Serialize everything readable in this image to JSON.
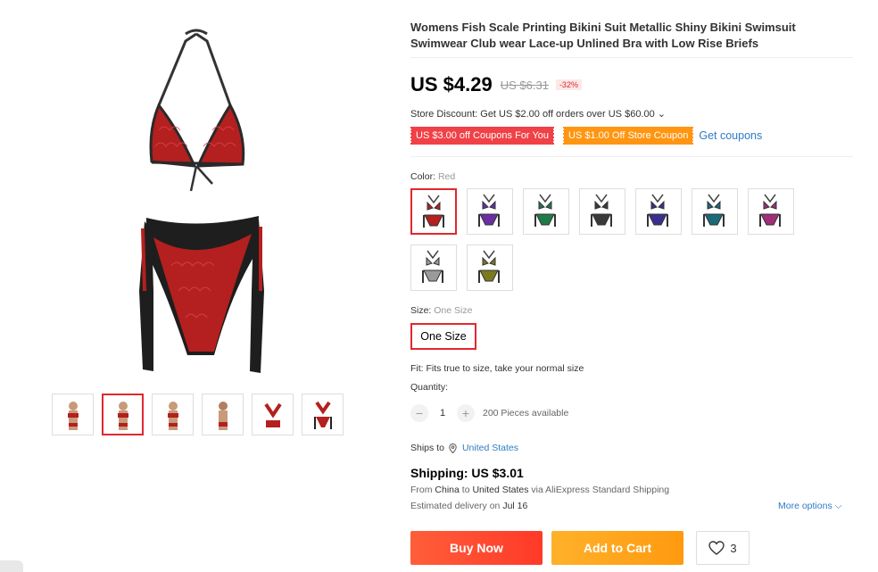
{
  "product": {
    "title": "Womens Fish Scale Printing Bikini Suit Metallic Shiny Bikini Swimsuit Swimwear Club wear Lace-up Unlined Bra with Low Rise Briefs",
    "price": "US $4.29",
    "original_price": "US $6.31",
    "discount": "-32%"
  },
  "store_discount": "Store Discount: Get US $2.00 off orders over US $60.00 ⌄",
  "coupons": {
    "coupon1": "US $3.00 off Coupons For You",
    "coupon2": "US $1.00 Off Store Coupon",
    "get_coupons": "Get coupons"
  },
  "color": {
    "label": "Color: ",
    "selected": "Red",
    "swatches": [
      {
        "color": "#b3201f"
      },
      {
        "color": "#6a2fa0"
      },
      {
        "color": "#1f7a4a"
      },
      {
        "color": "#3a3a3a"
      },
      {
        "color": "#3a2f8f"
      },
      {
        "color": "#1a6a7a"
      },
      {
        "color": "#a02f7a"
      },
      {
        "color": "#9a9a9a"
      },
      {
        "color": "#7a7a20"
      }
    ]
  },
  "size": {
    "label": "Size: ",
    "selected": "One Size",
    "option": "One Size"
  },
  "fit": "Fit: Fits true to size, take your normal size",
  "quantity": {
    "label": "Quantity:",
    "value": "1",
    "available": "200 Pieces available",
    "minus": "−",
    "plus": "+"
  },
  "shipping": {
    "ships_to_label": "Ships to",
    "country": "United States",
    "cost": "Shipping: US $3.01",
    "from_prefix": "From ",
    "from_origin": "China",
    "from_mid": " to ",
    "from_dest": "United States",
    "from_suffix": " via AliExpress Standard Shipping",
    "delivery_prefix": "Estimated delivery on ",
    "delivery_date": "Jul 16",
    "more_options": "More options ⌵"
  },
  "actions": {
    "buy_now": "Buy Now",
    "add_to_cart": "Add to Cart",
    "wishlist_count": "3"
  },
  "colors": {
    "price_red": "#e0282e",
    "link_blue": "#2e7bc4",
    "buy_gradient_end": "#ff3a28",
    "cart_gradient_end": "#ff9a10"
  }
}
